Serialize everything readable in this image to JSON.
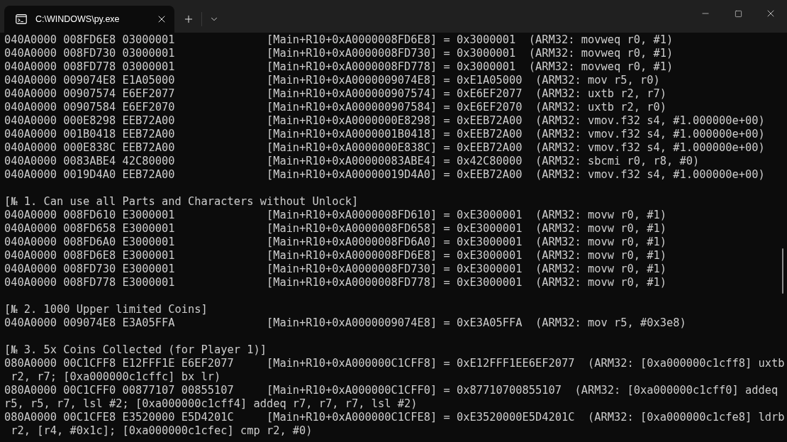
{
  "tab": {
    "title": "C:\\WINDOWS\\py.exe",
    "selected": true
  },
  "sections": [
    {
      "lines": [
        "040A0000 008FD6E8 03000001              [Main+R10+0xA0000008FD6E8] = 0x3000001  (ARM32: movweq r0, #1)",
        "040A0000 008FD730 03000001              [Main+R10+0xA0000008FD730] = 0x3000001  (ARM32: movweq r0, #1)",
        "040A0000 008FD778 03000001              [Main+R10+0xA0000008FD778] = 0x3000001  (ARM32: movweq r0, #1)",
        "040A0000 009074E8 E1A05000              [Main+R10+0xA0000009074E8] = 0xE1A05000  (ARM32: mov r5, r0)",
        "040A0000 00907574 E6EF2077              [Main+R10+0xA000000907574] = 0xE6EF2077  (ARM32: uxtb r2, r7)",
        "040A0000 00907584 E6EF2070              [Main+R10+0xA000000907584] = 0xE6EF2070  (ARM32: uxtb r2, r0)",
        "040A0000 000E8298 EEB72A00              [Main+R10+0xA0000000E8298] = 0xEEB72A00  (ARM32: vmov.f32 s4, #1.000000e+00)",
        "040A0000 001B0418 EEB72A00              [Main+R10+0xA0000001B0418] = 0xEEB72A00  (ARM32: vmov.f32 s4, #1.000000e+00)",
        "040A0000 000E838C EEB72A00              [Main+R10+0xA0000000E838C] = 0xEEB72A00  (ARM32: vmov.f32 s4, #1.000000e+00)",
        "040A0000 0083ABE4 42C80000              [Main+R10+0xA00000083ABE4] = 0x42C80000  (ARM32: sbcmi r0, r8, #0)",
        "040A0000 0019D4A0 EEB72A00              [Main+R10+0xA00000019D4A0] = 0xEEB72A00  (ARM32: vmov.f32 s4, #1.000000e+00)"
      ]
    },
    {
      "header": "[№ 1. Can use all Parts and Characters without Unlock]",
      "lines": [
        "040A0000 008FD610 E3000001              [Main+R10+0xA0000008FD610] = 0xE3000001  (ARM32: movw r0, #1)",
        "040A0000 008FD658 E3000001              [Main+R10+0xA0000008FD658] = 0xE3000001  (ARM32: movw r0, #1)",
        "040A0000 008FD6A0 E3000001              [Main+R10+0xA0000008FD6A0] = 0xE3000001  (ARM32: movw r0, #1)",
        "040A0000 008FD6E8 E3000001              [Main+R10+0xA0000008FD6E8] = 0xE3000001  (ARM32: movw r0, #1)",
        "040A0000 008FD730 E3000001              [Main+R10+0xA0000008FD730] = 0xE3000001  (ARM32: movw r0, #1)",
        "040A0000 008FD778 E3000001              [Main+R10+0xA0000008FD778] = 0xE3000001  (ARM32: movw r0, #1)"
      ]
    },
    {
      "header": "[№ 2. 1000 Upper limited Coins]",
      "lines": [
        "040A0000 009074E8 E3A05FFA              [Main+R10+0xA0000009074E8] = 0xE3A05FFA  (ARM32: mov r5, #0x3e8)"
      ]
    },
    {
      "header": "[№ 3. 5x Coins Collected (for Player 1)]",
      "lines": [
        "080A0000 00C1CFF8 E12FFF1E E6EF2077     [Main+R10+0xA000000C1CFF8] = 0xE12FFF1EE6EF2077  (ARM32: [0xa000000c1cff8] uxtb r2, r7; [0xa000000c1cffc] bx lr)",
        "080A0000 00C1CFF0 00877107 00855107     [Main+R10+0xA000000C1CFF0] = 0x87710700855107  (ARM32: [0xa000000c1cff0] addeq r5, r5, r7, lsl #2; [0xa000000c1cff4] addeq r7, r7, r7, lsl #2)",
        "080A0000 00C1CFE8 E3520000 E5D4201C     [Main+R10+0xA000000C1CFE8] = 0xE3520000E5D4201C  (ARM32: [0xa000000c1cfe8] ldrb r2, [r4, #0x1c]; [0xa000000c1cfec] cmp r2, #0)"
      ]
    }
  ]
}
